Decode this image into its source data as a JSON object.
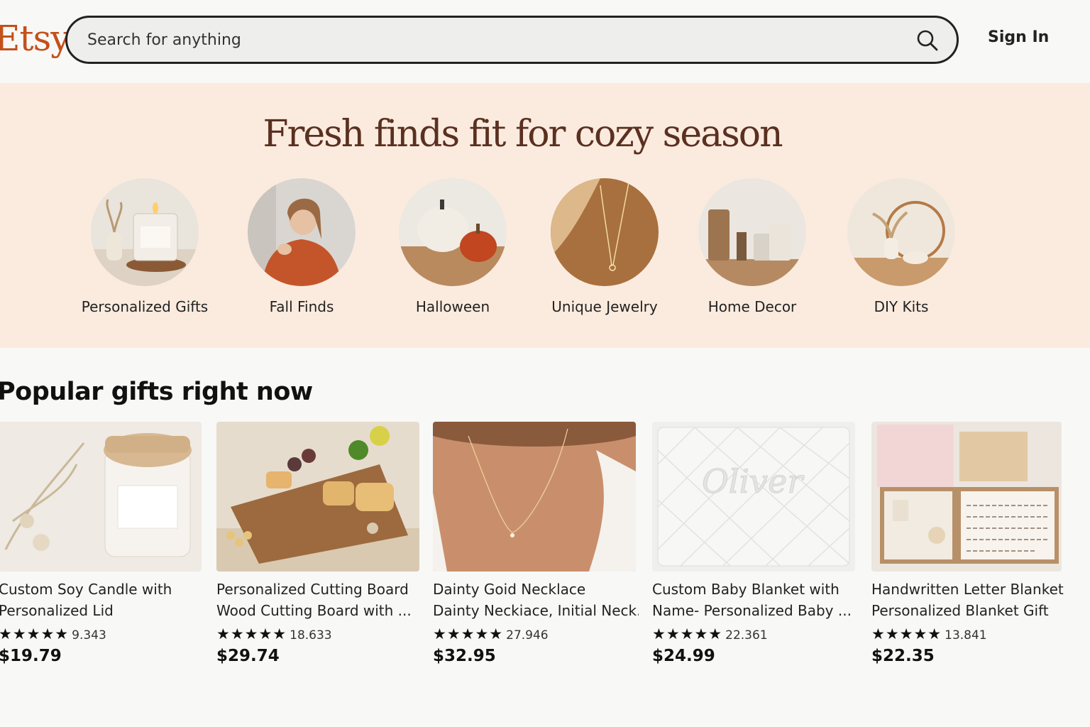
{
  "header": {
    "logo": "Etsy",
    "search_placeholder": "Search for anything",
    "sign_in": "Sign In"
  },
  "hero": {
    "title": "Fresh finds fit for cozy season",
    "categories": [
      {
        "label": "Personalized Gifts"
      },
      {
        "label": "Fall Finds"
      },
      {
        "label": "Halloween"
      },
      {
        "label": "Unique Jewelry"
      },
      {
        "label": "Home Decor"
      },
      {
        "label": "DIY Kits"
      }
    ]
  },
  "popular": {
    "title": "Popular gifts right now",
    "items": [
      {
        "title_line1": "Custom Soy Candle with",
        "title_line2": "Personalized Lid",
        "stars": "★★★★★",
        "reviews": "9.343",
        "price": "$19.79"
      },
      {
        "title_line1": "Personalized Cutting Board",
        "title_line2": "Wood Cutting Board with ...",
        "stars": "★★★★★",
        "reviews": "18.633",
        "price": "$29.74"
      },
      {
        "title_line1": "Dainty Goid Necklace",
        "title_line2": "Dainty Neckiace, Initial Neck...",
        "stars": "★★★★★",
        "reviews": "27.946",
        "price": "$32.95"
      },
      {
        "title_line1": "Custom Baby Blanket with",
        "title_line2": "Name- Personalized Baby ...",
        "stars": "★★★★★",
        "reviews": "22.361",
        "price": "$24.99"
      },
      {
        "title_line1": "Handwritten Letter Blanket",
        "title_line2": "Personalized Blanket Gift",
        "stars": "★★★★★",
        "reviews": "13.841",
        "price": "$22.35"
      }
    ]
  }
}
